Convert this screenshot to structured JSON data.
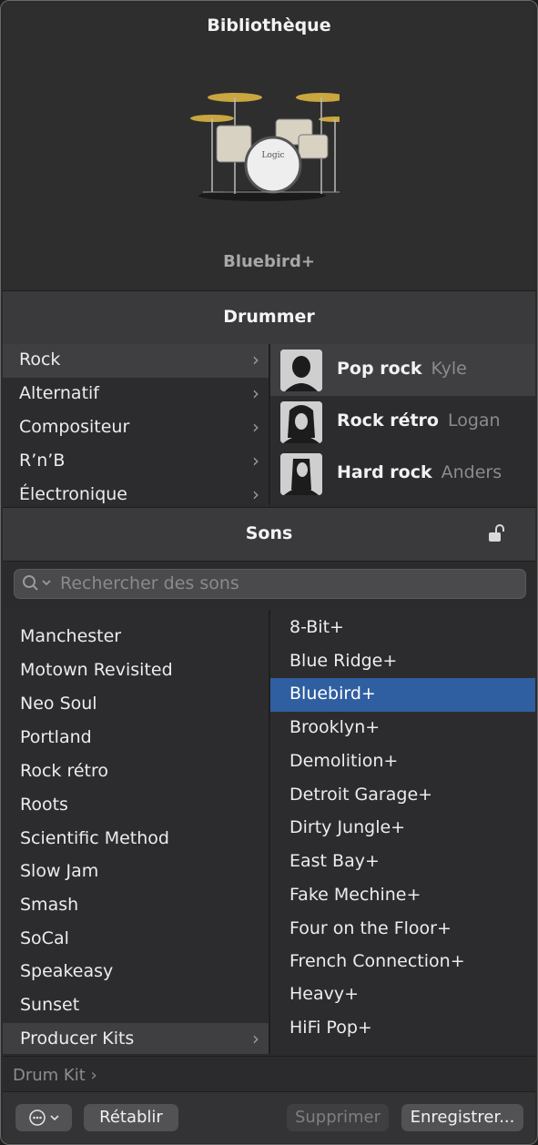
{
  "library": {
    "title": "Bibliothèque",
    "kit_name": "Bluebird+"
  },
  "drummer": {
    "title": "Drummer",
    "genres": [
      {
        "label": "Rock"
      },
      {
        "label": "Alternatif"
      },
      {
        "label": "Compositeur"
      },
      {
        "label": "R’n’B"
      },
      {
        "label": "Électronique"
      }
    ],
    "selected_genre": "Rock",
    "drummers": [
      {
        "style": "Pop rock",
        "name": "Kyle"
      },
      {
        "style": "Rock rétro",
        "name": "Logan"
      },
      {
        "style": "Hard rock",
        "name": "Anders"
      }
    ],
    "selected_drummer": "Pop rock"
  },
  "sounds": {
    "title": "Sons",
    "search_placeholder": "Rechercher des sons",
    "categories": [
      {
        "label": "Manchester"
      },
      {
        "label": "Motown Revisited"
      },
      {
        "label": "Neo Soul"
      },
      {
        "label": "Portland"
      },
      {
        "label": "Rock rétro"
      },
      {
        "label": "Roots"
      },
      {
        "label": "Scientific Method"
      },
      {
        "label": "Slow Jam"
      },
      {
        "label": "Smash"
      },
      {
        "label": "SoCal"
      },
      {
        "label": "Speakeasy"
      },
      {
        "label": "Sunset"
      },
      {
        "label": "Producer Kits"
      }
    ],
    "selected_category": "Producer Kits",
    "presets": [
      {
        "label": "8-Bit+"
      },
      {
        "label": "Blue Ridge+"
      },
      {
        "label": "Bluebird+"
      },
      {
        "label": "Brooklyn+"
      },
      {
        "label": "Demolition+"
      },
      {
        "label": "Detroit Garage+"
      },
      {
        "label": "Dirty Jungle+"
      },
      {
        "label": "East Bay+"
      },
      {
        "label": "Fake Mechine+"
      },
      {
        "label": "Four on the Floor+"
      },
      {
        "label": "French Connection+"
      },
      {
        "label": "Heavy+"
      },
      {
        "label": "HiFi Pop+"
      }
    ],
    "selected_preset": "Bluebird+"
  },
  "path_bar": {
    "label": "Drum Kit ›"
  },
  "footer": {
    "revert_label": "Rétablir",
    "delete_label": "Supprimer",
    "save_label": "Enregistrer..."
  },
  "colors": {
    "selection_blue": "#2f5fa0",
    "background": "#2c2c2e"
  },
  "icons": [
    "more-options-icon",
    "lock-open-icon",
    "search-icon",
    "chevron-right-icon",
    "chevron-down-icon"
  ]
}
